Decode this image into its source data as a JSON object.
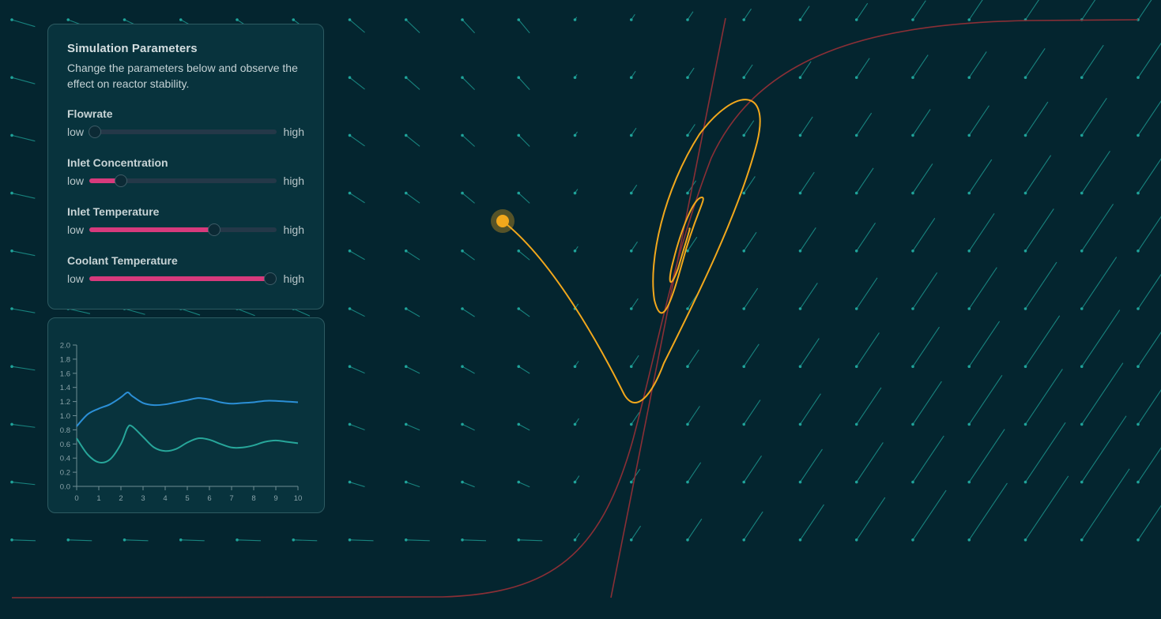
{
  "panel": {
    "title": "Simulation Parameters",
    "description": "Change the parameters below and observe the effect on reactor stability."
  },
  "sliders": [
    {
      "label": "Flowrate",
      "low": "low",
      "high": "high",
      "value": 0.03
    },
    {
      "label": "Inlet Concentration",
      "low": "low",
      "high": "high",
      "value": 0.17
    },
    {
      "label": "Inlet Temperature",
      "low": "low",
      "high": "high",
      "value": 0.67
    },
    {
      "label": "Coolant Temperature",
      "low": "low",
      "high": "high",
      "value": 0.97
    }
  ],
  "colors": {
    "background": "#04252f",
    "vector_field": "#1fa39a",
    "nullcline": "#8a2f36",
    "trajectory": "#f2a81c",
    "slider_fill": "#d73a7c",
    "series_1": "#2b8fd6",
    "series_2": "#27a69a"
  },
  "state_marker_icon": "circle-marker",
  "chart_data": {
    "type": "line",
    "x": [
      0,
      0.5,
      1,
      1.5,
      2,
      2.3,
      2.5,
      3,
      3.5,
      4,
      4.5,
      5,
      5.5,
      6,
      6.5,
      7,
      7.5,
      8,
      8.5,
      9,
      9.5,
      10
    ],
    "xticks": [
      "0",
      "1",
      "2",
      "3",
      "4",
      "5",
      "6",
      "7",
      "8",
      "9",
      "10"
    ],
    "yticks": [
      "0.0",
      "0.2",
      "0.4",
      "0.6",
      "0.8",
      "1.0",
      "1.2",
      "1.4",
      "1.6",
      "1.8",
      "2.0"
    ],
    "xlim": [
      0,
      10
    ],
    "ylim": [
      0,
      2.0
    ],
    "series": [
      {
        "values": [
          0.85,
          1.02,
          1.1,
          1.16,
          1.26,
          1.33,
          1.28,
          1.18,
          1.15,
          1.16,
          1.19,
          1.22,
          1.25,
          1.23,
          1.19,
          1.17,
          1.18,
          1.19,
          1.21,
          1.21,
          1.2,
          1.19
        ]
      },
      {
        "values": [
          0.68,
          0.45,
          0.34,
          0.38,
          0.6,
          0.83,
          0.85,
          0.7,
          0.55,
          0.5,
          0.53,
          0.62,
          0.68,
          0.66,
          0.6,
          0.55,
          0.55,
          0.58,
          0.63,
          0.65,
          0.63,
          0.61
        ]
      }
    ],
    "grid": false,
    "legend": "none"
  }
}
